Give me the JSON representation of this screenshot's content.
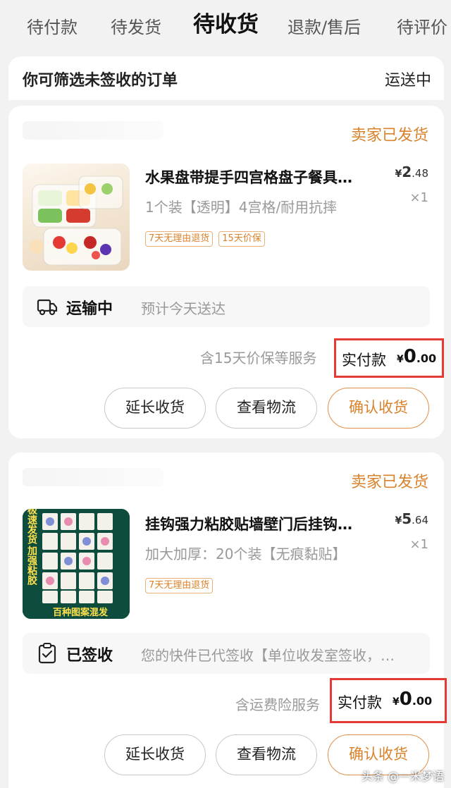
{
  "tabs": [
    {
      "label": "待付款"
    },
    {
      "label": "待发货"
    },
    {
      "label": "待收货"
    },
    {
      "label": "退款/售后"
    },
    {
      "label": "待评价"
    }
  ],
  "filter": {
    "text": "你可筛选未签收的订单",
    "status": "运送中"
  },
  "orders": [
    {
      "seller_status": "卖家已发货",
      "title": "水果盘带提手四宫格盘子餐具…",
      "spec": "1个装【透明】4宫格/耐用抗摔",
      "price_symbol": "¥",
      "price_int": "2",
      "price_dec": ".48",
      "qty": "×1",
      "tags": [
        "7天无理由退货",
        "15天价保"
      ],
      "logistics_status": "运输中",
      "logistics_detail": "预计今天送达",
      "service_note": "含15天价保等服务",
      "pay_label": "实付款",
      "pay_symbol": "¥",
      "pay_int": "0",
      "pay_dec": ".00",
      "buttons": [
        "延长收货",
        "查看物流",
        "确认收货"
      ]
    },
    {
      "seller_status": "卖家已发货",
      "title": "挂钩强力粘胶贴墙壁门后挂钩…",
      "spec": "加大加厚：20个装【无痕黏贴】",
      "price_symbol": "¥",
      "price_int": "5",
      "price_dec": ".64",
      "qty": "×1",
      "tags": [
        "7天无理由退货"
      ],
      "logistics_status": "已签收",
      "logistics_detail": "您的快件已代签收【单位收发室签收，…",
      "service_note": "含运费险服务",
      "pay_label": "实付款",
      "pay_symbol": "¥",
      "pay_int": "0",
      "pay_dec": ".00",
      "buttons": [
        "延长收货",
        "查看物流",
        "确认收货"
      ],
      "image_text": [
        "极速发货",
        "加强粘胶",
        "百种图案混发"
      ]
    }
  ],
  "watermark": "头条 @一米梦语",
  "colors": {
    "accent": "#d9822b",
    "highlight_box": "#e53935"
  }
}
